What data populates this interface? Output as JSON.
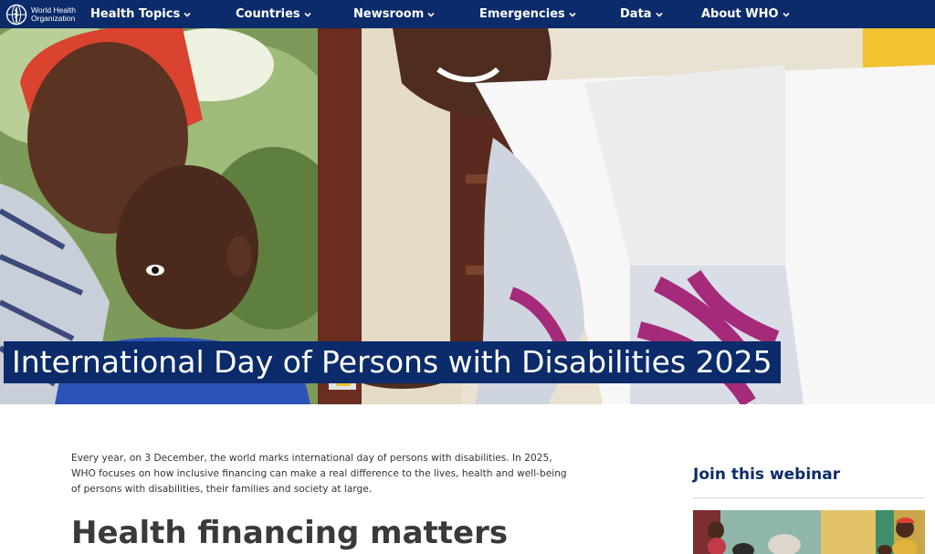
{
  "brand": {
    "logo_text": "World Health Organization",
    "color": "#0b2b6a"
  },
  "nav": {
    "items": [
      {
        "label": "Health Topics",
        "icon": "chevron-down-icon"
      },
      {
        "label": "Countries",
        "icon": "chevron-down-icon"
      },
      {
        "label": "Newsroom",
        "icon": "chevron-down-icon"
      },
      {
        "label": "Emergencies",
        "icon": "chevron-down-icon"
      },
      {
        "label": "Data",
        "icon": "chevron-down-icon"
      },
      {
        "label": "About WHO",
        "icon": "chevron-down-icon"
      }
    ]
  },
  "hero": {
    "title": "International Day of Persons with Disabilities 2025",
    "image": "photo-health-worker-with-mother-and-child"
  },
  "main": {
    "intro": "Every year, on 3 December, the world marks international day of persons with disabilities. In 2025, WHO focuses on how inclusive financing can make a real difference to the lives, health and well-being of persons with disabilities, their families and society at large.",
    "heading": "Health financing matters"
  },
  "sidebar": {
    "title": "Join this webinar",
    "thumbnail": "webinar-thumbnail-photo"
  },
  "colors": {
    "nav_bg": "#0b2b6a",
    "title_bg": "#0b2b6a",
    "heading_text": "#3a3a3a",
    "accent_text": "#0b2b6a"
  }
}
